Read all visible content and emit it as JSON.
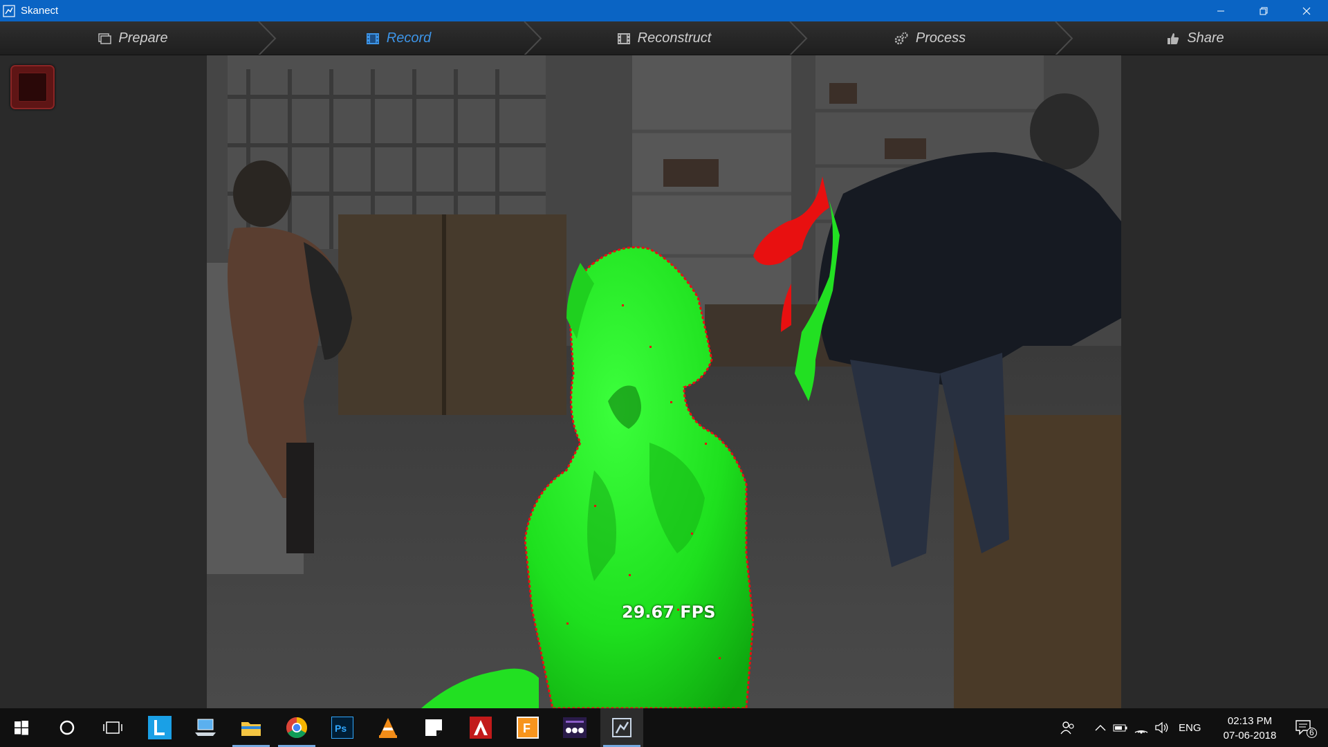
{
  "window": {
    "title": "Skanect",
    "controls": [
      "minimize-icon",
      "restore-icon",
      "close-icon"
    ]
  },
  "steps": [
    {
      "label": "Prepare",
      "icon": "prepare-icon",
      "active": false
    },
    {
      "label": "Record",
      "icon": "film-icon",
      "active": true
    },
    {
      "label": "Reconstruct",
      "icon": "film-icon",
      "active": false
    },
    {
      "label": "Process",
      "icon": "gears-icon",
      "active": false
    },
    {
      "label": "Share",
      "icon": "thumbs-up-icon",
      "active": false
    }
  ],
  "viewport": {
    "fps_label": "29.67 FPS"
  },
  "colors": {
    "titlebar": "#0a64c4",
    "active_step": "#3d95e8",
    "scan_green": "#22e022",
    "scan_red": "#e81010",
    "record_button": "#5e1515"
  },
  "taskbar": {
    "apps": [
      "start-icon",
      "cortana-icon",
      "task-view-icon",
      "l-app-icon",
      "laptop-app-icon",
      "file-explorer-icon",
      "chrome-icon",
      "photoshop-icon",
      "vlc-icon",
      "sticky-notes-icon",
      "autocad-icon",
      "fusion-icon",
      "dots-app-icon",
      "skanect-icon"
    ],
    "language": "ENG",
    "time": "02:13 PM",
    "date": "07-06-2018",
    "notification_count": "6"
  }
}
